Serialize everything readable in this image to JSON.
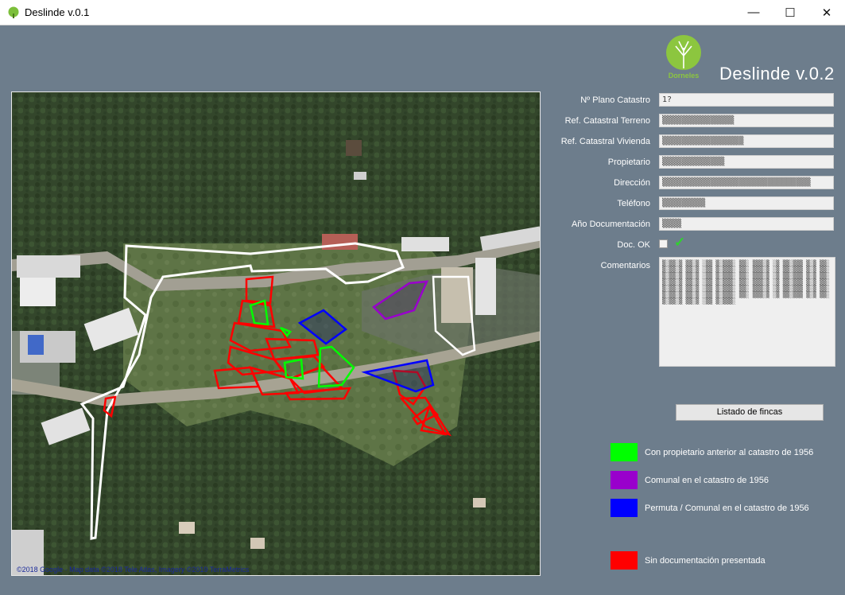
{
  "window": {
    "title": "Deslinde v.0.1",
    "minimize_glyph": "—",
    "maximize_glyph": "☐",
    "close_glyph": "✕"
  },
  "brand": {
    "title": "Deslinde v.0.2",
    "logo_text": "Dorneles",
    "logo_icon": "tree-icon"
  },
  "map": {
    "credit": "©2018 Google · Map data ©2018 Tele Atlas, Imagery ©2019 TerraMetrics"
  },
  "form": {
    "fields": [
      {
        "label": "Nº Plano Catastro",
        "value": "1?"
      },
      {
        "label": "Ref. Catastral Terreno",
        "value": "▒▒▒▒▒▒▒▒▒▒▒▒▒▒▒"
      },
      {
        "label": "Ref. Catastral Vivienda",
        "value": "▒▒▒▒▒▒▒▒▒▒▒▒▒▒▒▒▒"
      },
      {
        "label": "Propietario",
        "value": "▒▒▒▒▒▒▒▒▒▒▒▒▒"
      },
      {
        "label": "Dirección",
        "value": "▒▒▒▒▒▒▒▒▒▒▒▒▒▒▒▒▒▒▒▒▒▒▒▒▒▒▒▒▒▒▒"
      },
      {
        "label": "Teléfono",
        "value": "▒▒▒▒▒▒▒▒▒"
      },
      {
        "label": "Año Documentación",
        "value": "▒▒▒▒"
      }
    ],
    "doc_ok_label": "Doc. OK",
    "doc_ok_checked": true,
    "comments_label": "Comentarios",
    "comments_value": "▒░▒▒░▒ ▒▒░▒ ░▒▒ ▒░▒▒▒░ ▒▒░ ▒▒▒░▒ ░▒ ▒▒░▒▒▒ ▒░▒ ▒▒░ ▒░▒▒░▒ ▒▒░▒ ░▒▒ ▒░▒▒▒░ ▒▒░ ▒▒▒░▒ ░▒ ▒▒░▒▒▒ ▒░▒ ▒▒░ ▒░▒▒░▒ ▒▒░▒ ░▒▒ ▒░▒▒▒░ ▒▒░ ▒▒▒░▒ ░▒ ▒▒░▒▒▒ ▒░▒ ▒▒░ ▒░▒▒░▒ ▒▒░▒ ░▒▒ ▒░▒▒▒░ ▒▒░ ▒▒▒░▒ ░▒ ▒▒░▒▒▒ ▒░▒ ▒▒░ ▒░▒▒░▒ ▒▒░▒ ░▒▒ ▒░▒▒▒░ ▒▒░ ▒▒▒░▒ ░▒ ▒▒░▒▒▒ ▒░▒ ▒▒░ ▒░▒▒░▒ ▒▒░▒ ░▒▒ ▒░▒▒▒░ ▒▒░ ▒▒▒░▒ ░▒ ▒▒░▒▒▒ ▒░▒ ▒▒░ ▒░▒▒░▒ ▒▒░▒ ░▒▒ ▒░▒▒▒░"
  },
  "actions": {
    "list_button": "Listado de fincas"
  },
  "legend": [
    {
      "color": "#00ff00",
      "label": "Con propietario anterior al catastro de 1956"
    },
    {
      "color": "#9900cc",
      "label": "Comunal en el catastro de 1956"
    },
    {
      "color": "#0000ff",
      "label": "Permuta / Comunal en el catastro de 1956"
    },
    {
      "color": "#ff0000",
      "label": "Sin documentación presentada"
    }
  ]
}
